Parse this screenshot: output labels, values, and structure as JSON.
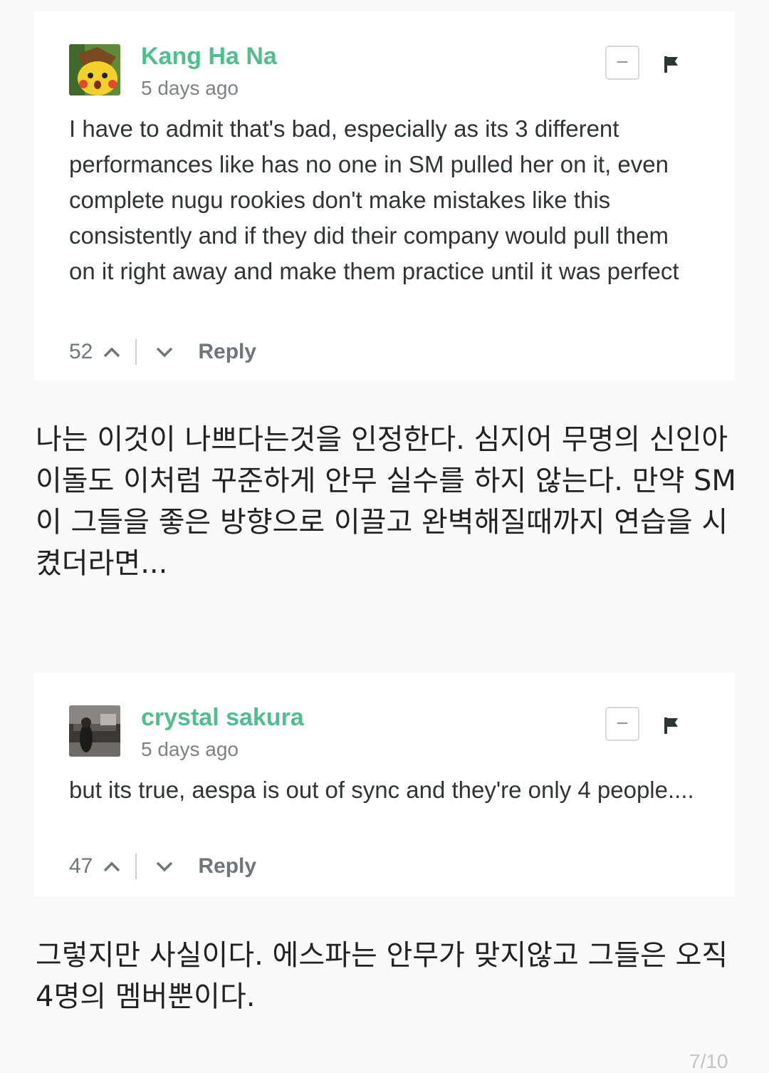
{
  "comments": [
    {
      "username": "Kang Ha Na",
      "timestamp": "5 days ago",
      "avatar_icon": "surprised-pikachu-avatar",
      "text": "I have to admit that's bad, especially as its 3 different performances like has no one in SM pulled her on it, even complete nugu rookies don't make mistakes like this consistently and if they did their company would pull them on it right away and make them practice until it was perfect",
      "votes": "52",
      "reply_label": "Reply",
      "collapse_symbol": "−"
    },
    {
      "username": "crystal sakura",
      "timestamp": "5 days ago",
      "avatar_icon": "photo-avatar",
      "text": "but its true, aespa is out of sync and they're only 4 people....",
      "votes": "47",
      "reply_label": "Reply",
      "collapse_symbol": "−"
    }
  ],
  "translations": [
    "나는 이것이 나쁘다는것을 인정한다. 심지어 무명의 신인아이돌도 이처럼 꾸준하게 안무 실수를 하지 않는다. 만약 SM이 그들을 좋은 방향으로 이끌고 완벽해질때까지 연습을 시켰더라면...",
    "그렇지만 사실이다. 에스파는 안무가 맞지않고 그들은 오직 4명의 멤버뿐이다."
  ],
  "page_indicator": "7/10",
  "colors": {
    "username": "#4fbf8e",
    "text": "#2f3437",
    "muted": "#7c8388",
    "background": "#fafafa"
  }
}
